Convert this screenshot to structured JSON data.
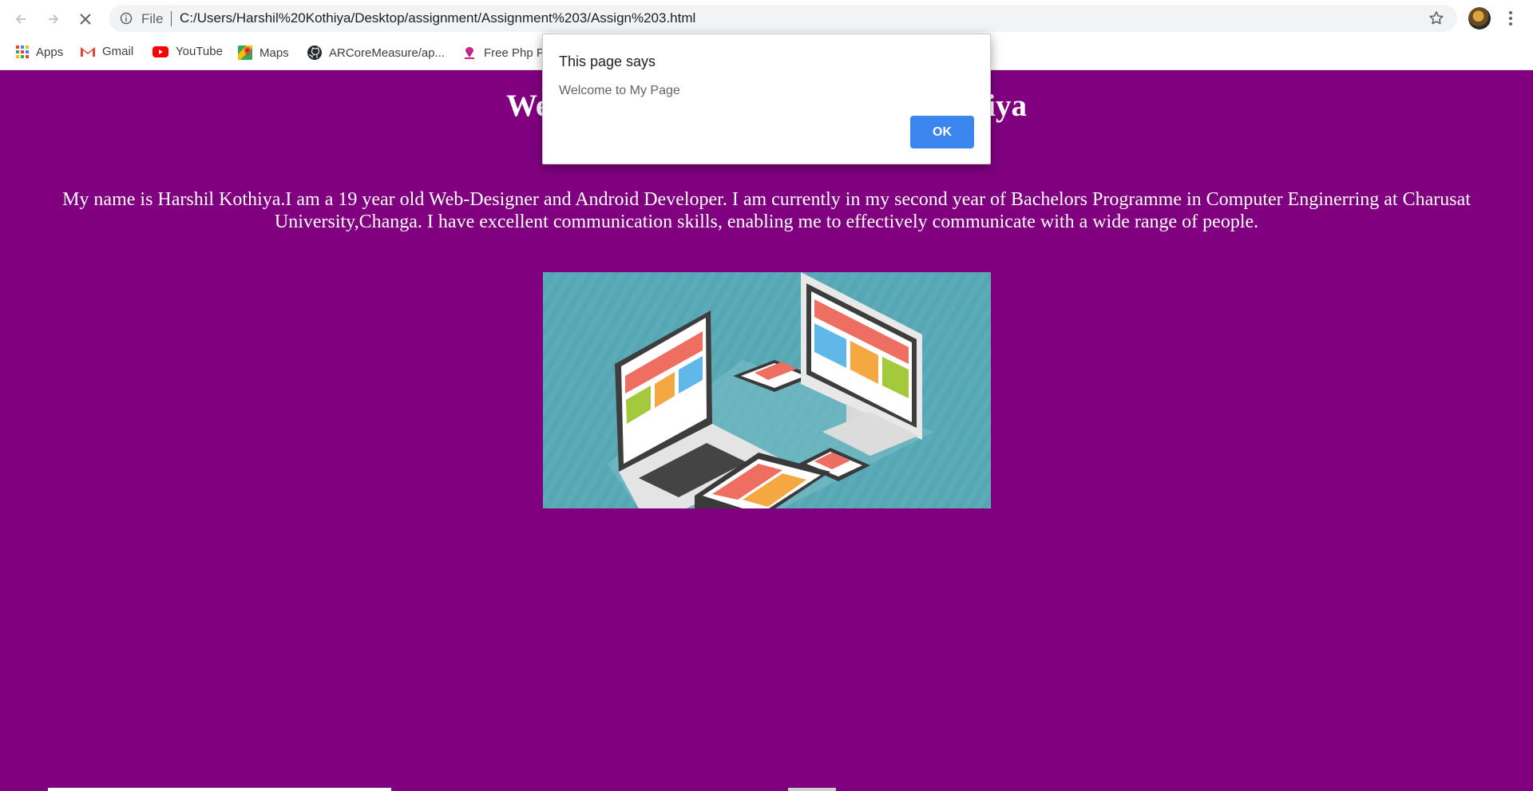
{
  "browser": {
    "address_scheme": "File",
    "url": "C:/Users/Harshil%20Kothiya/Desktop/assignment/Assignment%203/Assign%203.html",
    "bookmarks": [
      {
        "label": "Apps",
        "icon": "apps-grid-icon"
      },
      {
        "label": "Gmail",
        "icon": "gmail-icon"
      },
      {
        "label": "YouTube",
        "icon": "youtube-icon"
      },
      {
        "label": "Maps",
        "icon": "maps-icon"
      },
      {
        "label": "ARCoreMeasure/ap...",
        "icon": "github-icon"
      },
      {
        "label": "Free Php Pr",
        "icon": "php-icon"
      }
    ]
  },
  "page": {
    "title": "Welcome to My Page - Harshil Kothiya",
    "about": "My name is Harshil Kothiya.I am a 19 year old Web-Designer and Android Developer. I am currently in my second year of Bachelors Programme in Computer Enginerring at Charusat University,Changa. I have excellent communication skills, enabling me to effectively communicate with a wide range of people.",
    "background_color": "#800080"
  },
  "dialog": {
    "title": "This page says",
    "message": "Welcome to My Page",
    "ok_label": "OK"
  },
  "colors": {
    "accent_button": "#3b86ee",
    "image_background": "#57a7b3"
  }
}
